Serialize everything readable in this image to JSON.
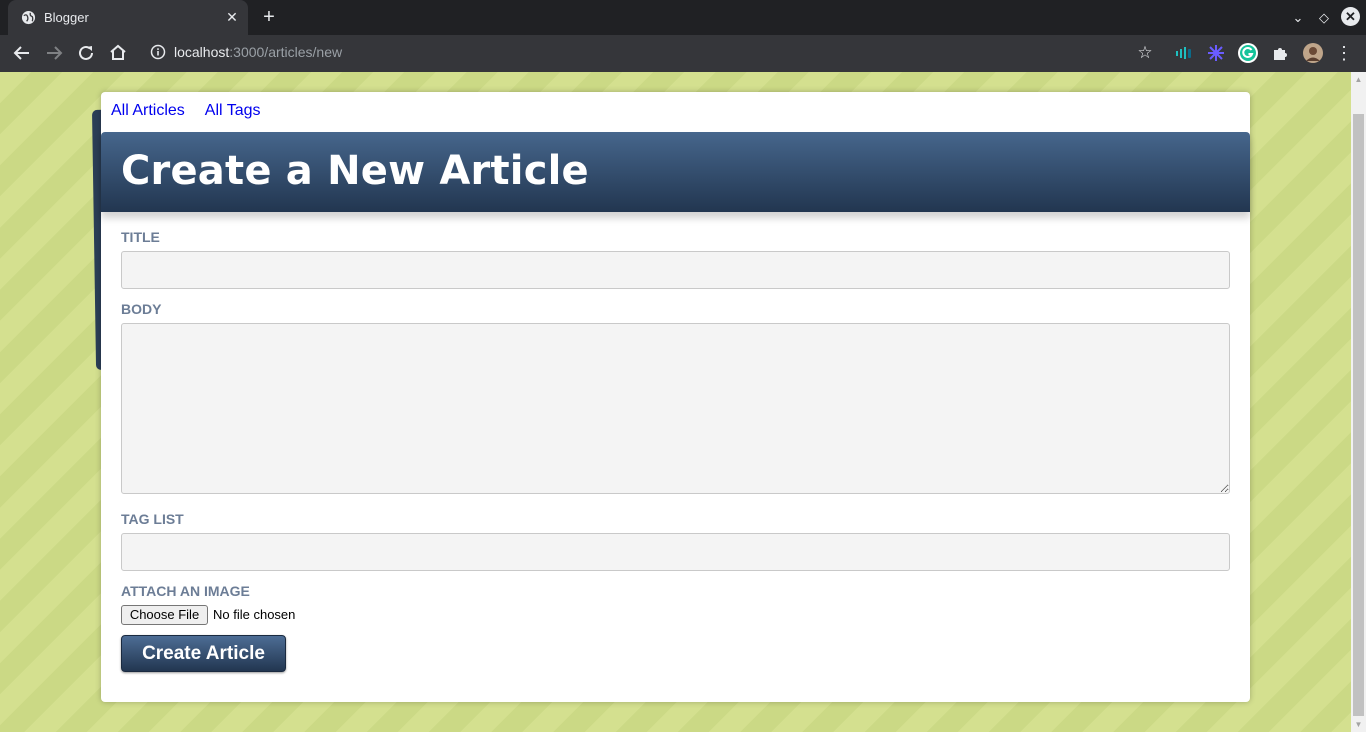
{
  "browser": {
    "tab_title": "Blogger",
    "url_host": "localhost",
    "url_path": ":3000/articles/new",
    "icons": {
      "favicon": "globe-icon",
      "back": "arrow-left-icon",
      "forward": "arrow-right-icon",
      "reload": "reload-icon",
      "home": "home-icon",
      "site_info": "info-icon",
      "bookmark": "star-icon",
      "extensions": [
        "audio-extension-icon",
        "flower-extension-icon",
        "grammarly-icon",
        "puzzle-icon",
        "profile-avatar"
      ],
      "menu": "kebab-menu-icon"
    }
  },
  "nav": {
    "all_articles": "All Articles",
    "all_tags": "All Tags"
  },
  "page": {
    "title": "Create a New Article"
  },
  "form": {
    "title_label": "TITLE",
    "title_value": "",
    "body_label": "BODY",
    "body_value": "",
    "tag_list_label": "TAG LIST",
    "tag_list_value": "",
    "image_label": "ATTACH AN IMAGE",
    "choose_file_label": "Choose File",
    "file_status": "No file chosen",
    "submit_label": "Create Article"
  },
  "colors": {
    "banner": "#2b4462",
    "label": "#6c7d96",
    "link": "#0000ee",
    "background": "#d4e08f"
  }
}
